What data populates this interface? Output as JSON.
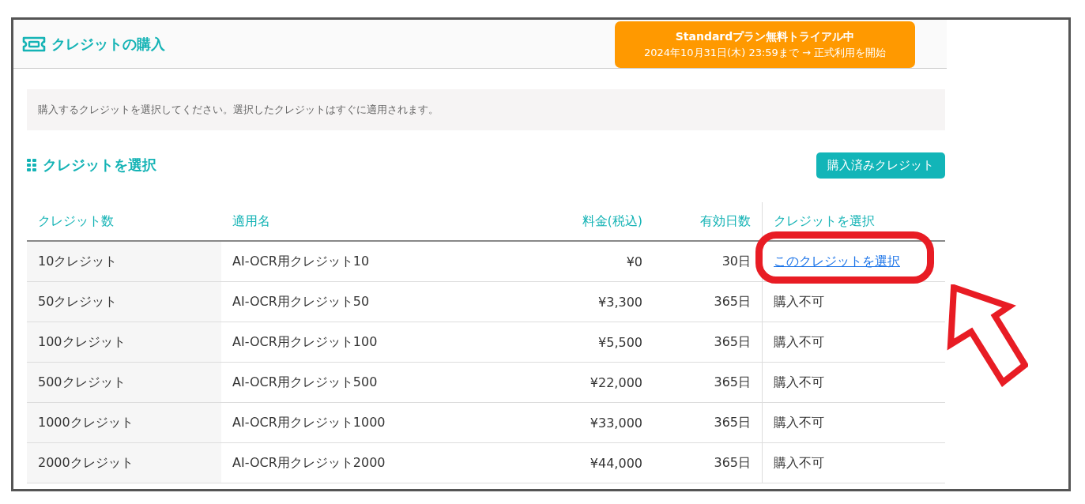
{
  "header": {
    "title": "クレジットの購入",
    "trial_badge": {
      "title": "Standardプラン無料トライアル中",
      "subtitle": "2024年10月31日(木) 23:59まで → 正式利用を開始"
    }
  },
  "notice": "購入するクレジットを選択してください。選択したクレジットはすぐに適用されます。",
  "section": {
    "title": "クレジットを選択",
    "button": "購入済みクレジット"
  },
  "table": {
    "columns": [
      "クレジット数",
      "適用名",
      "料金(税込)",
      "有効日数",
      "クレジットを選択"
    ],
    "rows": [
      {
        "credits": "10クレジット",
        "name": "AI-OCR用クレジット10",
        "price": "¥0",
        "days": "30日",
        "action": {
          "kind": "link",
          "text": "このクレジットを選択"
        },
        "highlighted": true
      },
      {
        "credits": "50クレジット",
        "name": "AI-OCR用クレジット50",
        "price": "¥3,300",
        "days": "365日",
        "action": {
          "kind": "text",
          "text": "購入不可"
        },
        "highlighted": false
      },
      {
        "credits": "100クレジット",
        "name": "AI-OCR用クレジット100",
        "price": "¥5,500",
        "days": "365日",
        "action": {
          "kind": "text",
          "text": "購入不可"
        },
        "highlighted": false
      },
      {
        "credits": "500クレジット",
        "name": "AI-OCR用クレジット500",
        "price": "¥22,000",
        "days": "365日",
        "action": {
          "kind": "text",
          "text": "購入不可"
        },
        "highlighted": false
      },
      {
        "credits": "1000クレジット",
        "name": "AI-OCR用クレジット1000",
        "price": "¥33,000",
        "days": "365日",
        "action": {
          "kind": "text",
          "text": "購入不可"
        },
        "highlighted": false
      },
      {
        "credits": "2000クレジット",
        "name": "AI-OCR用クレジット2000",
        "price": "¥44,000",
        "days": "365日",
        "action": {
          "kind": "text",
          "text": "購入不可"
        },
        "highlighted": false
      }
    ]
  }
}
